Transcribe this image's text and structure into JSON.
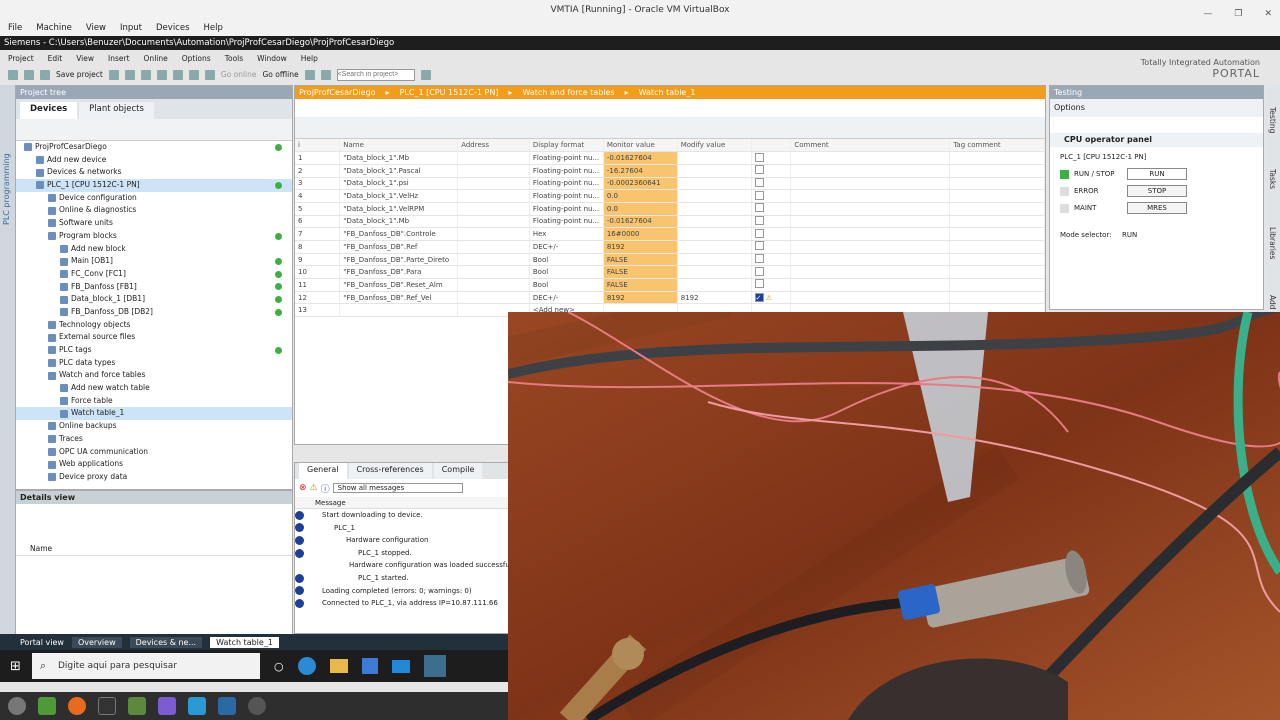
{
  "vbox": {
    "title": "VMTIA [Running] - Oracle VM VirtualBox",
    "menu": [
      "File",
      "Machine",
      "View",
      "Input",
      "Devices",
      "Help"
    ]
  },
  "tia": {
    "title": "Siemens  -  C:\\Users\\Benuzer\\Documents\\Automation\\ProjProfCesarDiego\\ProjProfCesarDiego",
    "menu": [
      "Project",
      "Edit",
      "View",
      "Insert",
      "Online",
      "Options",
      "Tools",
      "Window",
      "Help"
    ],
    "toolbar": {
      "save": "Save project",
      "go_online": "Go online",
      "go_offline": "Go offline",
      "search_placeholder": "<Search in project>"
    },
    "brand_line1": "Totally Integrated Automation",
    "brand_line2": "PORTAL",
    "side_label": "PLC programming"
  },
  "project_tree": {
    "header": "Project tree",
    "tabs": [
      "Devices",
      "Plant objects"
    ],
    "items": [
      {
        "label": "ProjProfCesarDiego",
        "indent": 0,
        "status": true
      },
      {
        "label": "Add new device",
        "indent": 1
      },
      {
        "label": "Devices & networks",
        "indent": 1
      },
      {
        "label": "PLC_1 [CPU 1512C-1 PN]",
        "indent": 1,
        "status": true,
        "sel": true
      },
      {
        "label": "Device configuration",
        "indent": 2
      },
      {
        "label": "Online & diagnostics",
        "indent": 2
      },
      {
        "label": "Software units",
        "indent": 2
      },
      {
        "label": "Program blocks",
        "indent": 2,
        "status": true
      },
      {
        "label": "Add new block",
        "indent": 3
      },
      {
        "label": "Main [OB1]",
        "indent": 3,
        "status": true
      },
      {
        "label": "FC_Conv [FC1]",
        "indent": 3,
        "status": true
      },
      {
        "label": "FB_Danfoss [FB1]",
        "indent": 3,
        "status": true
      },
      {
        "label": "Data_block_1 [DB1]",
        "indent": 3,
        "status": true
      },
      {
        "label": "FB_Danfoss_DB [DB2]",
        "indent": 3,
        "status": true
      },
      {
        "label": "Technology objects",
        "indent": 2
      },
      {
        "label": "External source files",
        "indent": 2
      },
      {
        "label": "PLC tags",
        "indent": 2,
        "status": true
      },
      {
        "label": "PLC data types",
        "indent": 2
      },
      {
        "label": "Watch and force tables",
        "indent": 2
      },
      {
        "label": "Add new watch table",
        "indent": 3
      },
      {
        "label": "Force table",
        "indent": 3
      },
      {
        "label": "Watch table_1",
        "indent": 3,
        "sel": true
      },
      {
        "label": "Online backups",
        "indent": 2
      },
      {
        "label": "Traces",
        "indent": 2
      },
      {
        "label": "OPC UA communication",
        "indent": 2
      },
      {
        "label": "Web applications",
        "indent": 2
      },
      {
        "label": "Device proxy data",
        "indent": 2
      }
    ],
    "details_header": "Details view",
    "details_col": "Name"
  },
  "editor": {
    "breadcrumb": [
      "ProjProfCesarDiego",
      "PLC_1 [CPU 1512C-1 PN]",
      "Watch and force tables",
      "Watch table_1"
    ],
    "columns": [
      "i",
      "Name",
      "Address",
      "Display format",
      "Monitor value",
      "Modify value",
      "",
      "Comment",
      "Tag comment"
    ],
    "rows": [
      [
        "1",
        "\"Data_block_1\".Mb",
        "",
        "Floating-point nu...",
        "-0.01627604",
        "",
        "",
        "",
        ""
      ],
      [
        "2",
        "\"Data_block_1\".Pascal",
        "",
        "Floating-point nu...",
        "-16.27604",
        "",
        "",
        "",
        ""
      ],
      [
        "3",
        "\"Data_block_1\".psi",
        "",
        "Floating-point nu...",
        "-0.0002360641",
        "",
        "",
        "",
        ""
      ],
      [
        "4",
        "\"Data_block_1\".VelHz",
        "",
        "Floating-point nu...",
        "0.0",
        "",
        "",
        "",
        ""
      ],
      [
        "5",
        "\"Data_block_1\".VelRPM",
        "",
        "Floating-point nu...",
        "0.0",
        "",
        "",
        "",
        ""
      ],
      [
        "6",
        "\"Data_block_1\".Mb",
        "",
        "Floating-point nu...",
        "-0.01627604",
        "",
        "",
        "",
        ""
      ],
      [
        "7",
        "\"FB_Danfoss_DB\".Controle",
        "",
        "Hex",
        "16#0000",
        "",
        "",
        "",
        ""
      ],
      [
        "8",
        "\"FB_Danfoss_DB\".Ref",
        "",
        "DEC+/-",
        "8192",
        "",
        "",
        "",
        ""
      ],
      [
        "9",
        "\"FB_Danfoss_DB\".Parte_Direto",
        "",
        "Bool",
        "FALSE",
        "",
        "",
        "",
        ""
      ],
      [
        "10",
        "\"FB_Danfoss_DB\".Para",
        "",
        "Bool",
        "FALSE",
        "",
        "",
        "",
        ""
      ],
      [
        "11",
        "\"FB_Danfoss_DB\".Reset_Alm",
        "",
        "Bool",
        "FALSE",
        "",
        "",
        "",
        ""
      ],
      [
        "12",
        "\"FB_Danfoss_DB\".Ref_Vel",
        "",
        "DEC+/-",
        "8192",
        "8192",
        "checked",
        "",
        ""
      ],
      [
        "13",
        "",
        "",
        "<Add new>",
        "",
        "",
        "",
        "",
        ""
      ]
    ]
  },
  "inspector": {
    "tabs": [
      "General",
      "Cross-references",
      "Compile"
    ],
    "filter": "Show all messages",
    "col": "Message",
    "messages": [
      "Start downloading to device.",
      "PLC_1",
      "Hardware configuration",
      "PLC_1 stopped.",
      "Hardware configuration was loaded successfully.",
      "PLC_1 started.",
      "Loading completed (errors: 0; warnings: 0)",
      "Connected to PLC_1, via address IP=10.87.111.66"
    ]
  },
  "testing": {
    "header": "Testing",
    "options": "Options",
    "panel": "CPU operator panel",
    "cpu": "PLC_1 [CPU 1512C-1 PN]",
    "run_stop": "RUN / STOP",
    "error": "ERROR",
    "maint": "MAINT",
    "btn_run": "RUN",
    "btn_stop": "STOP",
    "btn_mres": "MRES",
    "mode_label": "Mode selector:",
    "mode": "RUN",
    "side": [
      "Testing",
      "Tasks",
      "Libraries",
      "Add"
    ]
  },
  "portal": {
    "portal_view": "Portal view",
    "tabs": [
      "Overview",
      "Devices & ne...",
      "Watch table_1"
    ]
  },
  "windows": {
    "search": "Digite aqui para pesquisar"
  },
  "colors": {
    "accent": "#f29c1b",
    "monitor": "#f8c46d",
    "ok": "#3cb043"
  }
}
